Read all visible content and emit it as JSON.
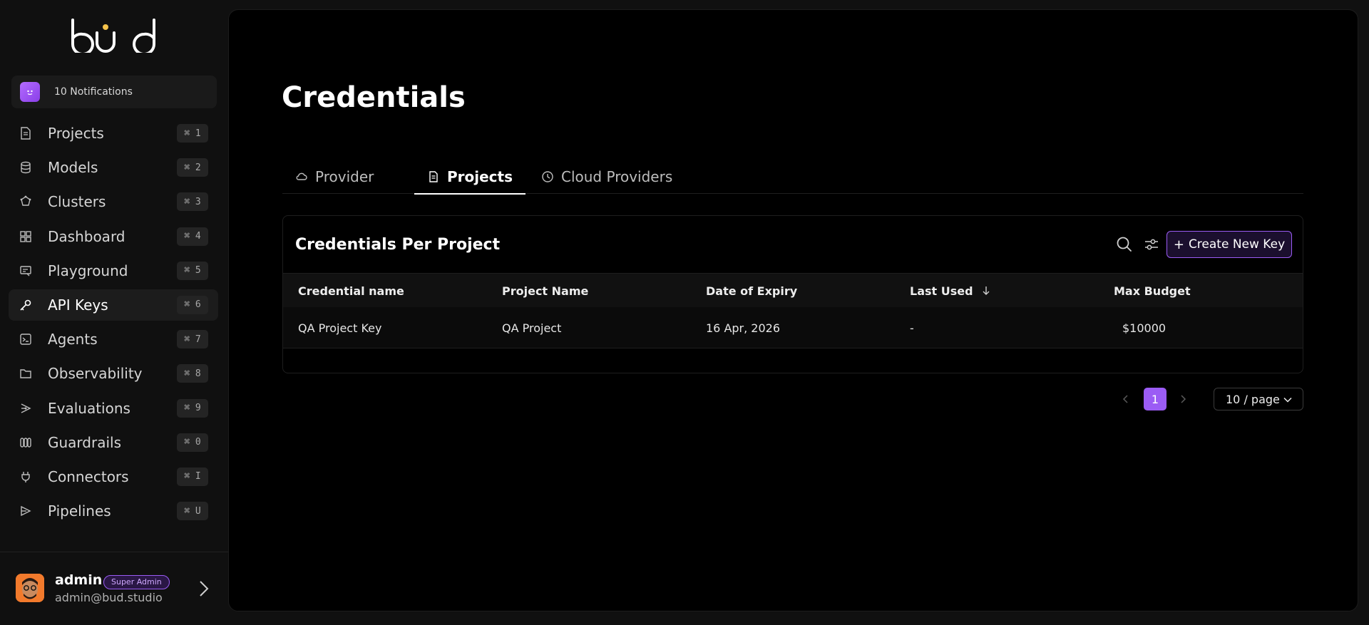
{
  "app": {
    "logo_text": "bud",
    "accent": "#9B5CF5"
  },
  "notifications": {
    "label": "10 Notifications"
  },
  "sidebar": {
    "items": [
      {
        "label": "Projects",
        "shortcut": "⌘ 1",
        "icon": "document-icon",
        "active": false
      },
      {
        "label": "Models",
        "shortcut": "⌘ 2",
        "icon": "database-icon",
        "active": false
      },
      {
        "label": "Clusters",
        "shortcut": "⌘ 3",
        "icon": "cluster-icon",
        "active": false
      },
      {
        "label": "Dashboard",
        "shortcut": "⌘ 4",
        "icon": "grid-icon",
        "active": false
      },
      {
        "label": "Playground",
        "shortcut": "⌘ 5",
        "icon": "playground-icon",
        "active": false
      },
      {
        "label": "API Keys",
        "shortcut": "⌘ 6",
        "icon": "key-icon",
        "active": true
      },
      {
        "label": "Agents",
        "shortcut": "⌘ 7",
        "icon": "terminal-icon",
        "active": false
      },
      {
        "label": "Observability",
        "shortcut": "⌘ 8",
        "icon": "folder-icon",
        "active": false
      },
      {
        "label": "Evaluations",
        "shortcut": "⌘ 9",
        "icon": "evaluation-icon",
        "active": false
      },
      {
        "label": "Guardrails",
        "shortcut": "⌘ 0",
        "icon": "guardrails-icon",
        "active": false
      },
      {
        "label": "Connectors",
        "shortcut": "⌘ I",
        "icon": "plug-icon",
        "active": false
      },
      {
        "label": "Pipelines",
        "shortcut": "⌘ U",
        "icon": "pipeline-icon",
        "active": false
      }
    ]
  },
  "user": {
    "name": "admin",
    "role": "Super Admin",
    "email": "admin@bud.studio"
  },
  "page": {
    "title": "Credentials"
  },
  "tabs": [
    {
      "label": "Provider",
      "icon": "cloud-icon",
      "active": false
    },
    {
      "label": "Projects",
      "icon": "document-icon",
      "active": true
    },
    {
      "label": "Cloud Providers",
      "icon": "clock-icon",
      "active": false
    }
  ],
  "card": {
    "title": "Credentials Per Project",
    "create_label": "Create New Key"
  },
  "table": {
    "columns": [
      "Credential name",
      "Project Name",
      "Date of Expiry",
      "Last Used",
      "Max Budget"
    ],
    "sorted_column": "Last Used",
    "rows": [
      [
        "QA Project Key",
        "QA Project",
        "16 Apr, 2026",
        "-",
        "$10000"
      ]
    ]
  },
  "pagination": {
    "current": "1",
    "page_size": "10 / page"
  }
}
